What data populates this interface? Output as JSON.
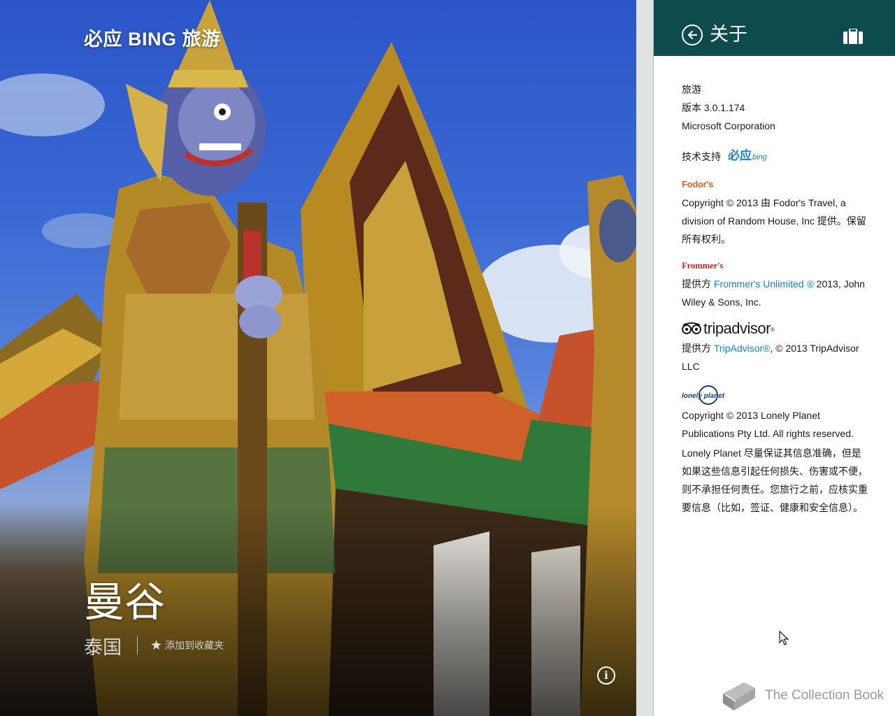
{
  "app": {
    "title": "必应 BING 旅游"
  },
  "destination": {
    "city": "曼谷",
    "country": "泰国",
    "add_favorite_label": "添加到收藏夹"
  },
  "about_panel": {
    "title": "关于",
    "app_name": "旅游",
    "version": "版本 3.0.1.174",
    "publisher": "Microsoft Corporation",
    "support_label": "技术支持",
    "support_logo": "必应",
    "support_logo_suffix": "bing",
    "fodors": {
      "logo": "Fodor's",
      "text": "Copyright © 2013 由 Fodor's Travel, a division of Random House, Inc 提供。保留所有权利。"
    },
    "frommers": {
      "logo": "Frommer's",
      "prefix": "提供方 ",
      "link": "Frommer's Unlimited ®",
      "suffix": " 2013, John Wiley & Sons, Inc."
    },
    "tripadvisor": {
      "logo": "tripadvisor",
      "logo_mark": "®",
      "prefix": "提供方 ",
      "link": "TripAdvisor®",
      "suffix": ", © 2013 TripAdvisor LLC"
    },
    "lonely_planet": {
      "logo": "lonely planet",
      "copyright": "Copyright © 2013 Lonely Planet Publications Pty Ltd. All rights reserved.",
      "disclaimer": "Lonely Planet 尽量保证其信息准确，但是如果这些信息引起任何损失、伤害或不便，则不承担任何责任。您旅行之前，应核实重要信息（比如，签证、健康和安全信息）。"
    }
  },
  "watermark": {
    "text": "The Collection Book"
  },
  "colors": {
    "header_bg": "#0e4b4f",
    "link": "#1c7fc8",
    "fodors": "#e0622a",
    "frommers": "#c32b2b"
  }
}
